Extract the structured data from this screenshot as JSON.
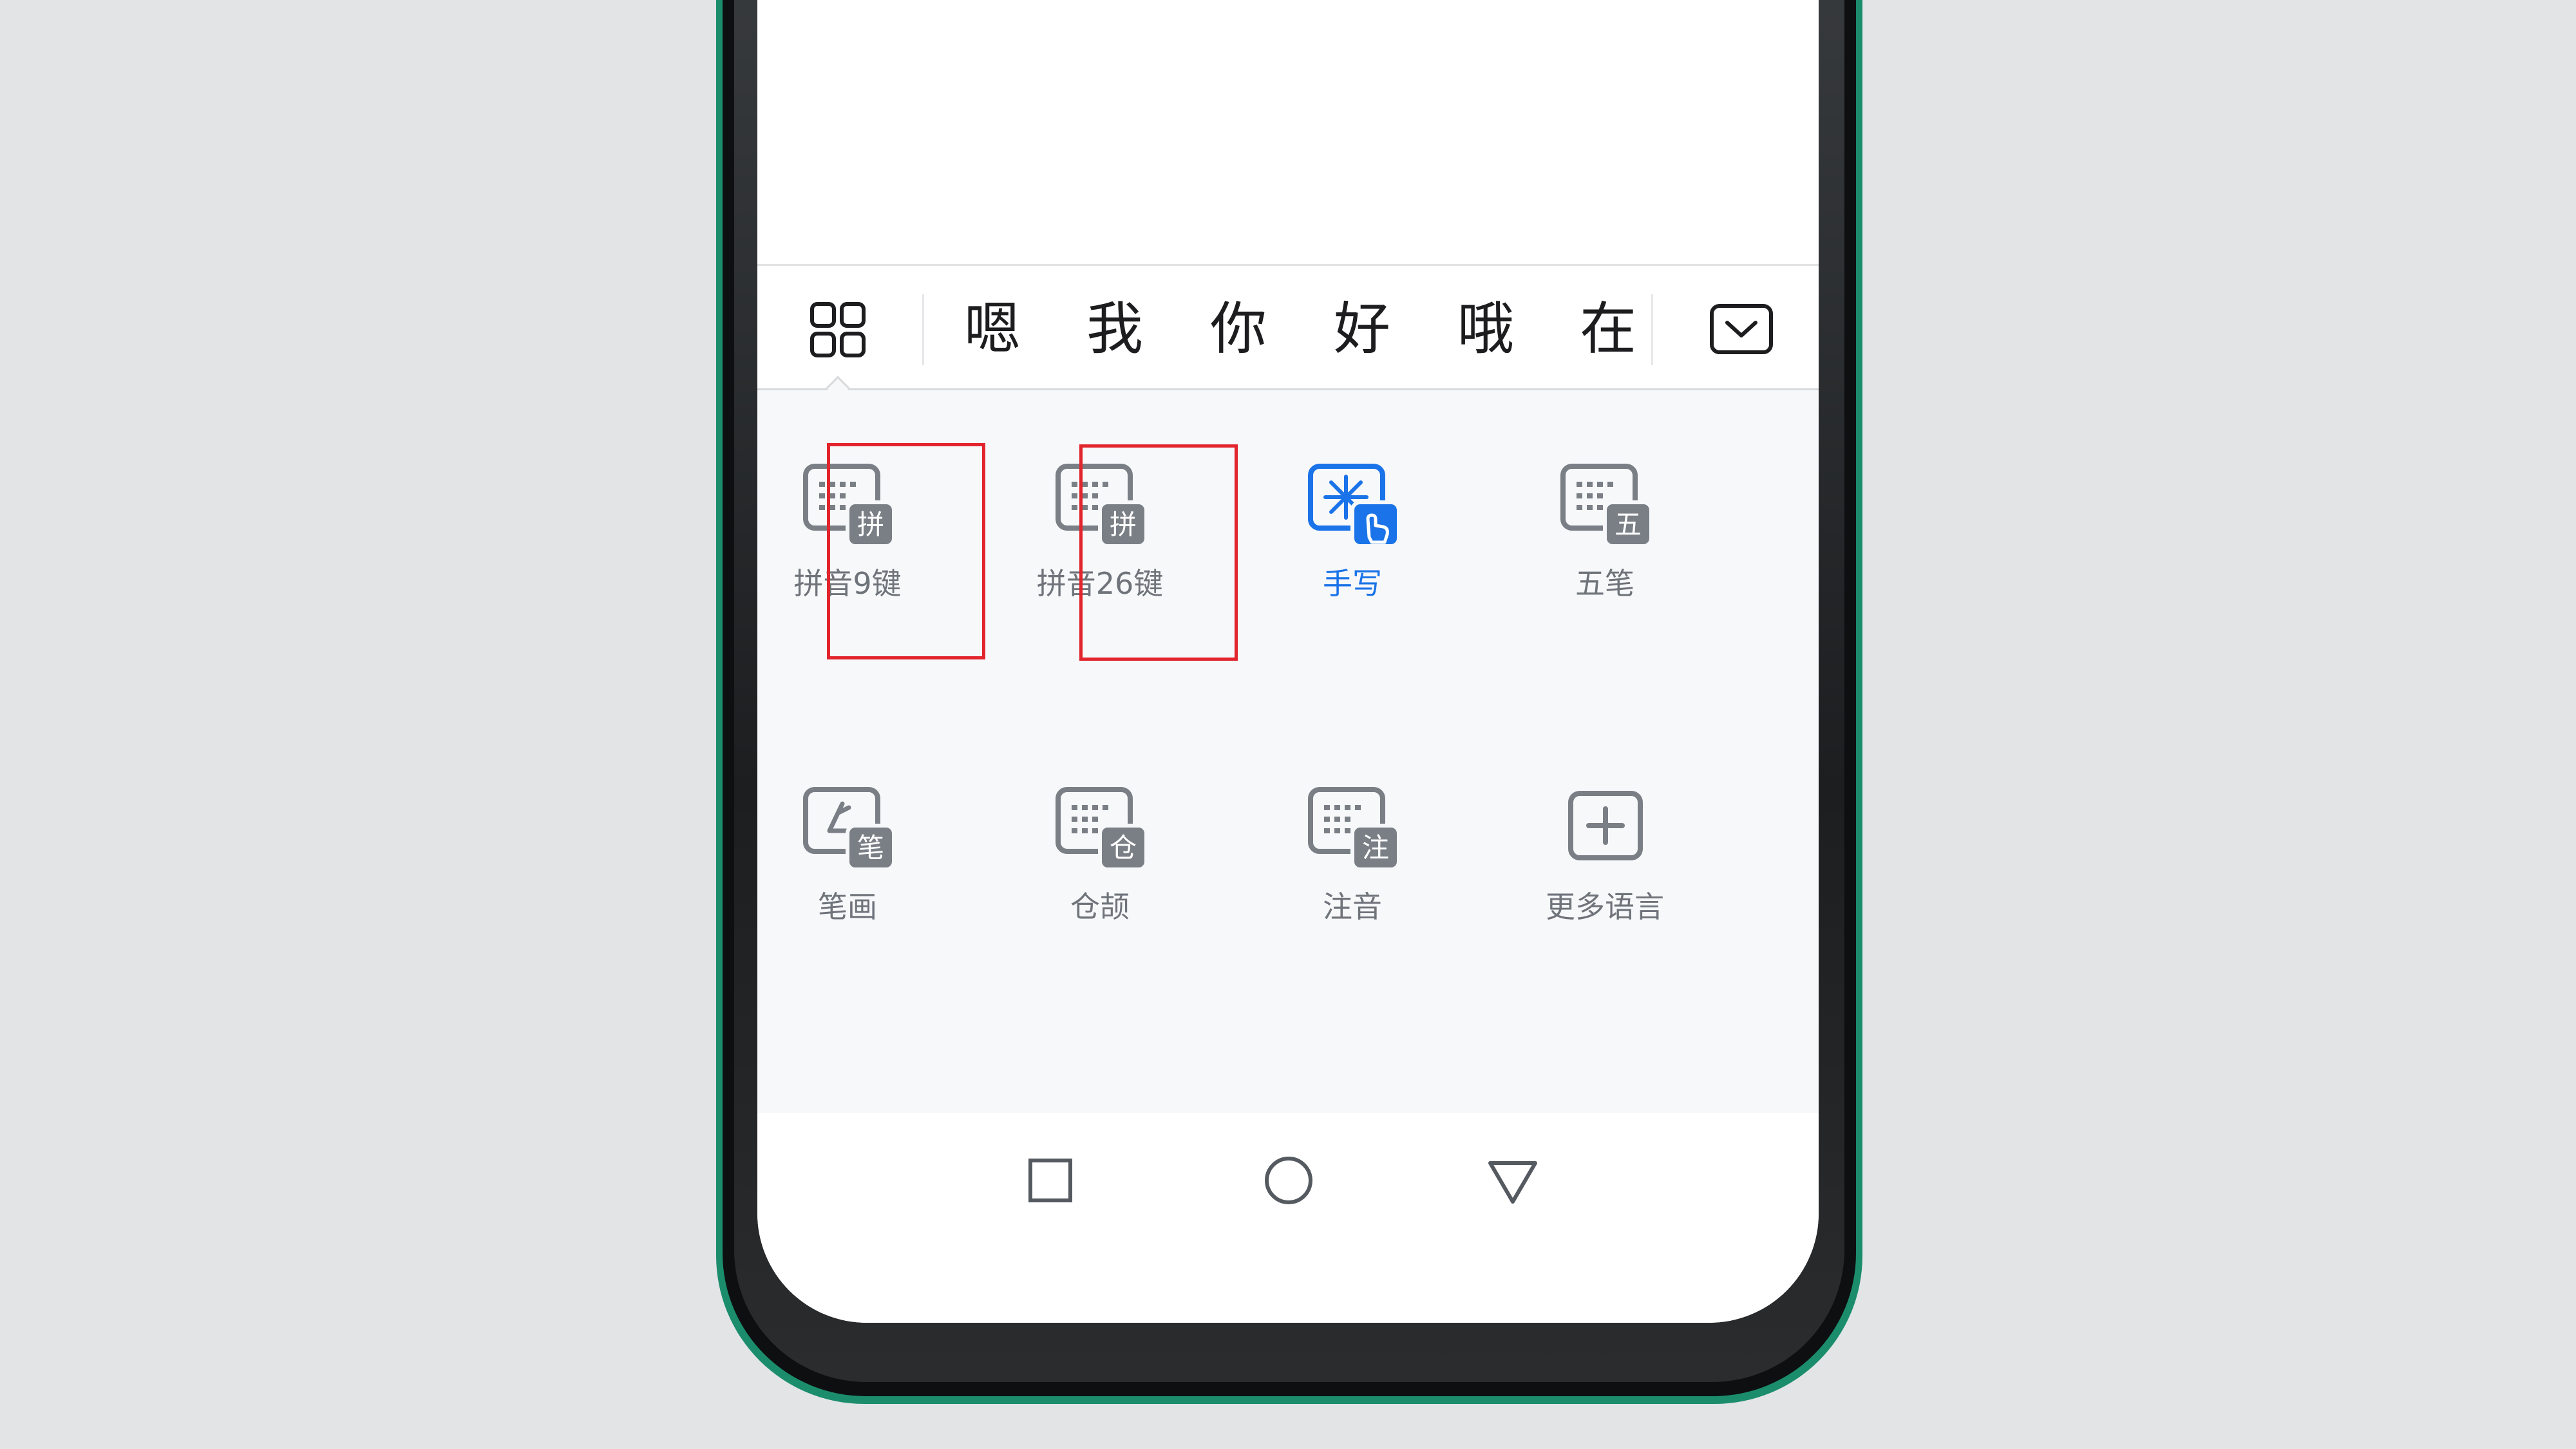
{
  "candidate_bar": {
    "candidates": [
      "嗯",
      "我",
      "你",
      "好",
      "哦",
      "在"
    ]
  },
  "layouts": {
    "items": [
      {
        "label": "拼音9键",
        "badge": "拼",
        "icon": "keyboard-icon",
        "selected": false
      },
      {
        "label": "拼音26键",
        "badge": "拼",
        "icon": "keyboard-icon",
        "selected": false
      },
      {
        "label": "手写",
        "icon": "handwriting-icon",
        "selected": true
      },
      {
        "label": "五笔",
        "badge": "五",
        "icon": "keyboard-icon",
        "selected": false
      },
      {
        "label": "笔画",
        "badge": "笔",
        "icon": "stroke-icon",
        "selected": false
      },
      {
        "label": "仓颉",
        "badge": "仓",
        "icon": "keyboard-icon",
        "selected": false
      },
      {
        "label": "注音",
        "badge": "注",
        "icon": "keyboard-icon",
        "selected": false
      },
      {
        "label": "更多语言",
        "icon": "plus-icon",
        "selected": false
      }
    ]
  },
  "nav": {
    "buttons": [
      "square-icon",
      "circle-icon",
      "triangle-icon"
    ]
  },
  "colors": {
    "accent": "#1a73e8",
    "icon_gray": "#7a7f86",
    "highlight": "#e2242c",
    "frame": "#1b8d6c"
  }
}
